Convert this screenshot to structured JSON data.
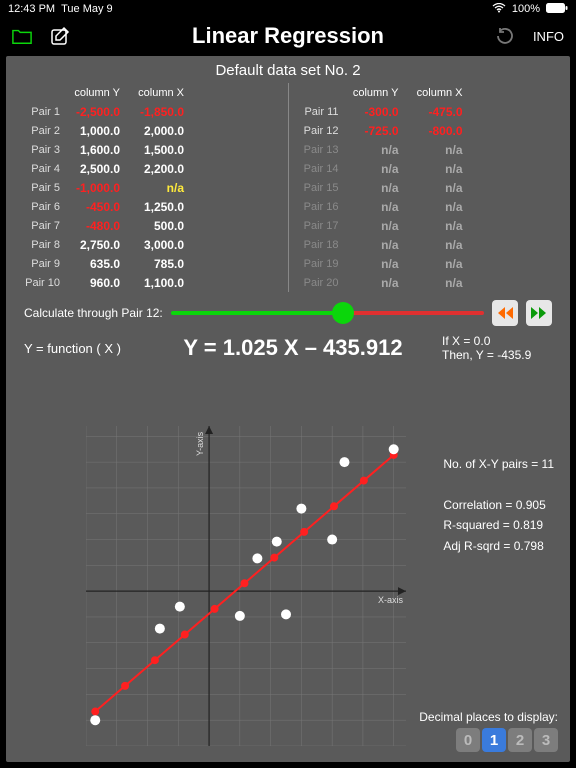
{
  "status": {
    "time": "12:43 PM",
    "date": "Tue May 9",
    "battery": "100%"
  },
  "header": {
    "title": "Linear Regression",
    "info": "INFO"
  },
  "subtitle": "Default data set No. 2",
  "columns": {
    "y": "column Y",
    "x": "column X"
  },
  "pairs_left": [
    {
      "lbl": "Pair 1",
      "y": "-2,500.0",
      "x": "-1,850.0",
      "yneg": true,
      "xneg": true
    },
    {
      "lbl": "Pair 2",
      "y": "1,000.0",
      "x": "2,000.0",
      "yneg": false,
      "xneg": false
    },
    {
      "lbl": "Pair 3",
      "y": "1,600.0",
      "x": "1,500.0",
      "yneg": false,
      "xneg": false
    },
    {
      "lbl": "Pair 4",
      "y": "2,500.0",
      "x": "2,200.0",
      "yneg": false,
      "xneg": false
    },
    {
      "lbl": "Pair 5",
      "y": "-1,000.0",
      "x": "n/a",
      "yneg": true,
      "xneg": false,
      "xylw": true
    },
    {
      "lbl": "Pair 6",
      "y": "-450.0",
      "x": "1,250.0",
      "yneg": true,
      "xneg": false
    },
    {
      "lbl": "Pair 7",
      "y": "-480.0",
      "x": "500.0",
      "yneg": true,
      "xneg": false
    },
    {
      "lbl": "Pair 8",
      "y": "2,750.0",
      "x": "3,000.0",
      "yneg": false,
      "xneg": false
    },
    {
      "lbl": "Pair 9",
      "y": "635.0",
      "x": "785.0",
      "yneg": false,
      "xneg": false
    },
    {
      "lbl": "Pair 10",
      "y": "960.0",
      "x": "1,100.0",
      "yneg": false,
      "xneg": false
    }
  ],
  "pairs_right": [
    {
      "lbl": "Pair 11",
      "y": "-300.0",
      "x": "-475.0",
      "yneg": true,
      "xneg": true,
      "na": false
    },
    {
      "lbl": "Pair 12",
      "y": "-725.0",
      "x": "-800.0",
      "yneg": true,
      "xneg": true,
      "na": false
    },
    {
      "lbl": "Pair 13",
      "y": "n/a",
      "x": "n/a",
      "na": true
    },
    {
      "lbl": "Pair 14",
      "y": "n/a",
      "x": "n/a",
      "na": true
    },
    {
      "lbl": "Pair 15",
      "y": "n/a",
      "x": "n/a",
      "na": true
    },
    {
      "lbl": "Pair 16",
      "y": "n/a",
      "x": "n/a",
      "na": true
    },
    {
      "lbl": "Pair 17",
      "y": "n/a",
      "x": "n/a",
      "na": true
    },
    {
      "lbl": "Pair 18",
      "y": "n/a",
      "x": "n/a",
      "na": true
    },
    {
      "lbl": "Pair 19",
      "y": "n/a",
      "x": "n/a",
      "na": true
    },
    {
      "lbl": "Pair 20",
      "y": "n/a",
      "x": "n/a",
      "na": true
    }
  ],
  "slider": {
    "label": "Calculate through Pair 12:"
  },
  "equation": {
    "func_label": "Y = function ( X )",
    "text": "Y = 1.025 X – 435.912",
    "if_x": "If X = 0.0",
    "then_y": "Then, Y = -435.9"
  },
  "stats": {
    "pairs": "No. of X-Y pairs = 11",
    "corr": "Correlation = 0.905",
    "r2": "R-squared = 0.819",
    "adj": "Adj R-sqrd = 0.798"
  },
  "axes": {
    "x": "X-axis",
    "y": "Y-axis"
  },
  "decimals": {
    "label": "Decimal places to display:",
    "opts": [
      "0",
      "1",
      "2",
      "3"
    ],
    "selected": 1
  },
  "chart_data": {
    "type": "scatter",
    "title": "",
    "xlabel": "X-axis",
    "ylabel": "Y-axis",
    "xlim": [
      -2000,
      3200
    ],
    "ylim": [
      -3000,
      3200
    ],
    "series": [
      {
        "name": "data points",
        "color": "#ffffff",
        "points": [
          {
            "x": -1850,
            "y": -2500
          },
          {
            "x": 2000,
            "y": 1000
          },
          {
            "x": 1500,
            "y": 1600
          },
          {
            "x": 2200,
            "y": 2500
          },
          {
            "x": 1250,
            "y": -450
          },
          {
            "x": 500,
            "y": -480
          },
          {
            "x": 3000,
            "y": 2750
          },
          {
            "x": 785,
            "y": 635
          },
          {
            "x": 1100,
            "y": 960
          },
          {
            "x": -475,
            "y": -300
          },
          {
            "x": -800,
            "y": -725
          }
        ]
      },
      {
        "name": "regression line",
        "color": "#ff2020",
        "type": "line",
        "slope": 1.025,
        "intercept": -435.912,
        "points": [
          {
            "x": -1850,
            "y": -2332
          },
          {
            "x": 3000,
            "y": 2639
          }
        ]
      }
    ]
  }
}
